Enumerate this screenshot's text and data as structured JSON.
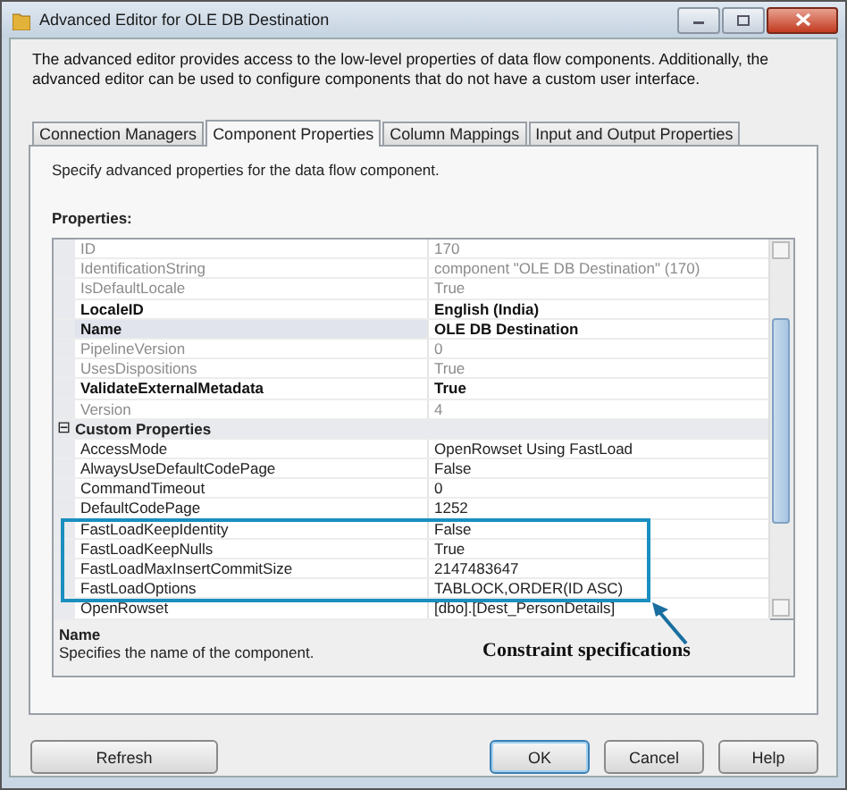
{
  "window": {
    "title": "Advanced Editor for OLE DB Destination"
  },
  "description": "The advanced editor provides access to the low-level properties of data flow components. Additionally, the advanced editor can be used to configure components that do not have a custom user interface.",
  "tabs": [
    {
      "label": "Connection Managers",
      "selected": false
    },
    {
      "label": "Component Properties",
      "selected": true
    },
    {
      "label": "Column Mappings",
      "selected": false
    },
    {
      "label": "Input and Output Properties",
      "selected": false
    }
  ],
  "panel": {
    "hint": "Specify advanced properties for the data flow component.",
    "properties_label": "Properties:"
  },
  "properties": [
    {
      "kind": "readonly",
      "name": "ID",
      "value": "170",
      "selected": false,
      "highlighted": false
    },
    {
      "kind": "readonly",
      "name": "IdentificationString",
      "value": "component \"OLE DB Destination\" (170)",
      "selected": false,
      "highlighted": false
    },
    {
      "kind": "readonly",
      "name": "IsDefaultLocale",
      "value": "True",
      "selected": false,
      "highlighted": false
    },
    {
      "kind": "modified",
      "name": "LocaleID",
      "value": "English (India)",
      "selected": false,
      "highlighted": false
    },
    {
      "kind": "modified",
      "name": "Name",
      "value": "OLE DB Destination",
      "selected": true,
      "highlighted": false
    },
    {
      "kind": "readonly",
      "name": "PipelineVersion",
      "value": "0",
      "selected": false,
      "highlighted": false
    },
    {
      "kind": "readonly",
      "name": "UsesDispositions",
      "value": "True",
      "selected": false,
      "highlighted": false
    },
    {
      "kind": "modified",
      "name": "ValidateExternalMetadata",
      "value": "True",
      "selected": false,
      "highlighted": false
    },
    {
      "kind": "readonly",
      "name": "Version",
      "value": "4",
      "selected": false,
      "highlighted": false
    },
    {
      "kind": "category",
      "name": "Custom Properties",
      "expander": "⊟",
      "expanded": true
    },
    {
      "kind": "normal",
      "name": "AccessMode",
      "value": "OpenRowset Using FastLoad",
      "selected": false,
      "highlighted": false
    },
    {
      "kind": "normal",
      "name": "AlwaysUseDefaultCodePage",
      "value": "False",
      "selected": false,
      "highlighted": false
    },
    {
      "kind": "normal",
      "name": "CommandTimeout",
      "value": "0",
      "selected": false,
      "highlighted": false
    },
    {
      "kind": "normal",
      "name": "DefaultCodePage",
      "value": "1252",
      "selected": false,
      "highlighted": false
    },
    {
      "kind": "normal",
      "name": "FastLoadKeepIdentity",
      "value": "False",
      "selected": false,
      "highlighted": true
    },
    {
      "kind": "normal",
      "name": "FastLoadKeepNulls",
      "value": "True",
      "selected": false,
      "highlighted": true
    },
    {
      "kind": "normal",
      "name": "FastLoadMaxInsertCommitSize",
      "value": "2147483647",
      "selected": false,
      "highlighted": true
    },
    {
      "kind": "normal",
      "name": "FastLoadOptions",
      "value": "TABLOCK,ORDER(ID ASC)",
      "selected": false,
      "highlighted": true
    },
    {
      "kind": "normal",
      "name": "OpenRowset",
      "value": "[dbo].[Dest_PersonDetails]",
      "selected": false,
      "highlighted": false
    }
  ],
  "property_description": {
    "title": "Name",
    "text": "Specifies the name of the component."
  },
  "annotation": {
    "text": "Constraint specifications"
  },
  "buttons": [
    {
      "label": "Refresh",
      "default": false
    },
    {
      "label": "OK",
      "default": true
    },
    {
      "label": "Cancel",
      "default": false
    },
    {
      "label": "Help",
      "default": false
    }
  ]
}
